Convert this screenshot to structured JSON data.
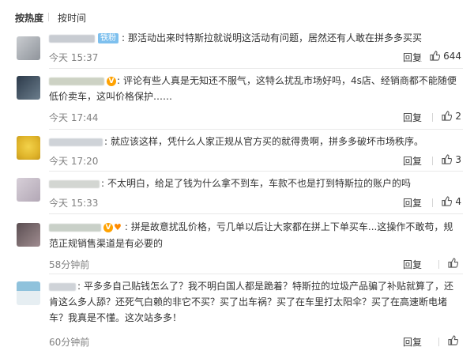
{
  "tabs": {
    "hot": "按热度",
    "time": "按时间"
  },
  "comments": [
    {
      "text": "那活动出来时特斯拉就说明这活动有问题，居然还有人敢在拼多多买买",
      "badge": "铁粉",
      "time": "今天 15:37",
      "reply": "回复",
      "likes": "644"
    },
    {
      "text": "评论有些人真是无知还不服气，这特么扰乱市场好吗，4s店、经销商都不能随便低价卖车，这叫价格保护……",
      "time": "今天 17:44",
      "reply": "回复",
      "likes": "2"
    },
    {
      "text": "就应该这样，凭什么人家正规从官方买的就得贵啊，拼多多破坏市场秩序。",
      "time": "今天 17:20",
      "reply": "回复",
      "likes": "3"
    },
    {
      "text": "不太明白，给足了钱为什么拿不到车，车款不也是打到特斯拉的账户的吗",
      "time": "今天 15:33",
      "reply": "回复",
      "likes": "4"
    },
    {
      "text": "拼是故意扰乱价格，亏几单以后让大家都在拼上下单买车...这操作不敢苟，规范正规销售渠道是有必要的",
      "time": "58分钟前",
      "reply": "回复",
      "likes": ""
    },
    {
      "text": "平多多自己贴钱怎么了？我不明白国人都是跪着？特斯拉的垃圾产品骗了补贴就算了，还肯这么多人舔？还死气白赖的非它不买？买了出车祸？买了在车里打太阳伞？买了在高速断电堵车？我真是不懂。这次站多多！",
      "time": "60分钟前",
      "reply": "回复",
      "likes": ""
    }
  ],
  "colors": {
    "badge": "#7ec0ee",
    "vip": "#ffa200",
    "meta": "#808080"
  }
}
